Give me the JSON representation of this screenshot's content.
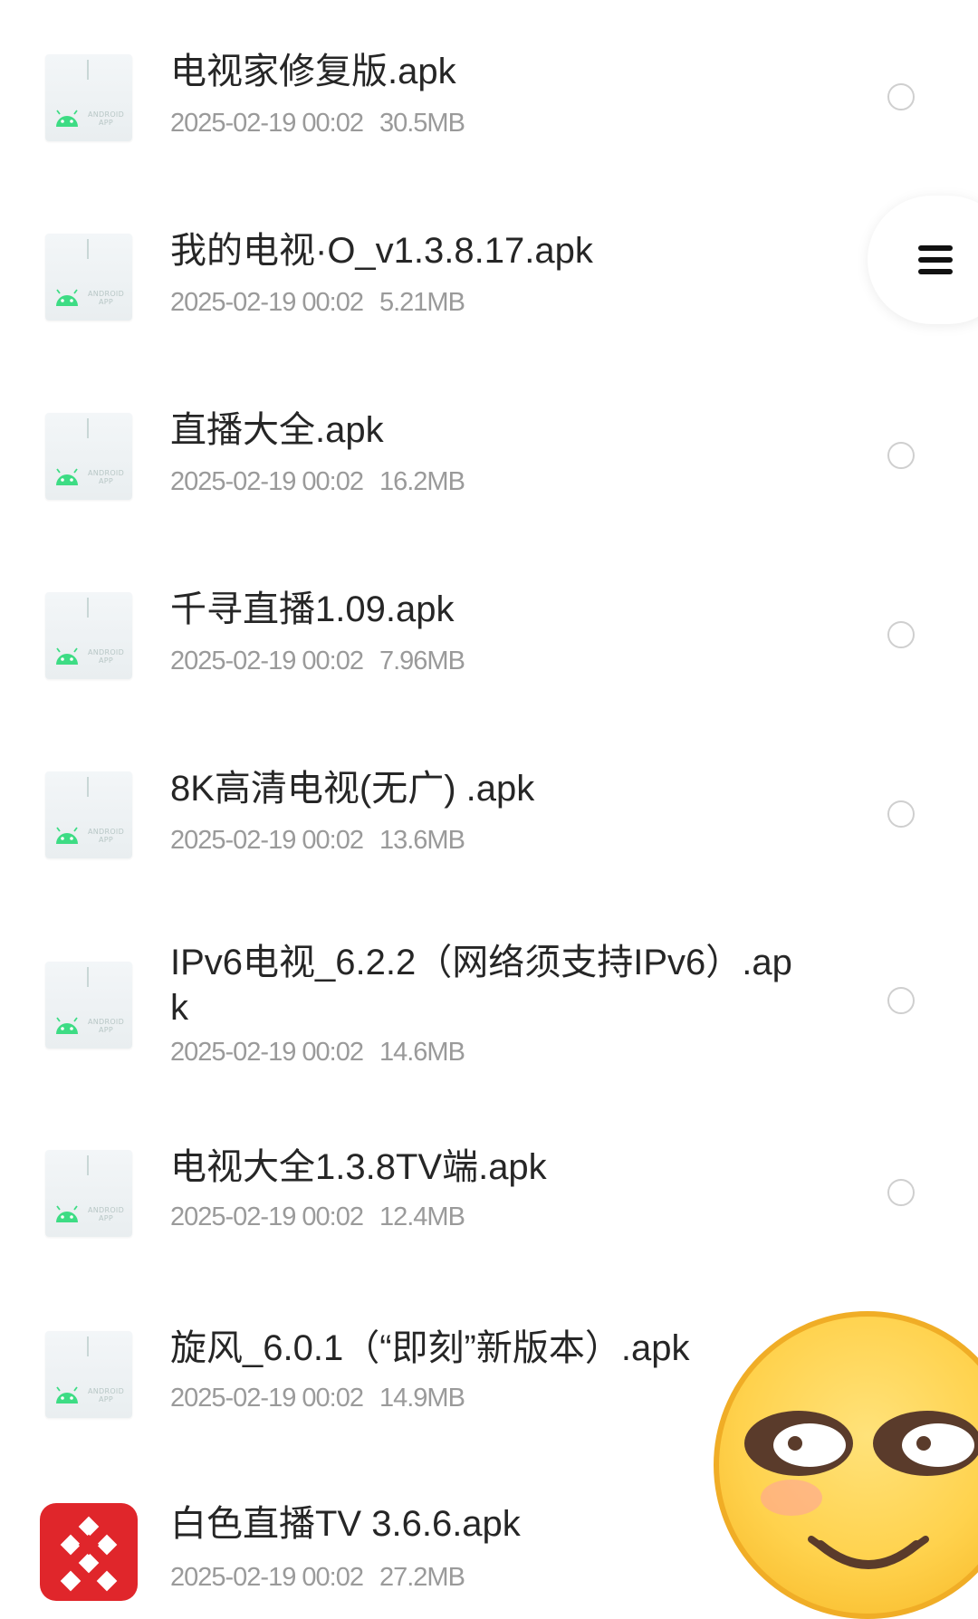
{
  "files": [
    {
      "name": "电视家修复版.apk",
      "date": "2025-02-19 00:02",
      "size": "30.5MB",
      "icon": "android-apk-icon",
      "has_radio": true
    },
    {
      "name": "我的电视·O_v1.3.8.17.apk",
      "date": "2025-02-19 00:02",
      "size": "5.21MB",
      "icon": "android-apk-icon",
      "has_radio": false
    },
    {
      "name": "直播大全.apk",
      "date": "2025-02-19 00:02",
      "size": "16.2MB",
      "icon": "android-apk-icon",
      "has_radio": true
    },
    {
      "name": "千寻直播1.09.apk",
      "date": "2025-02-19 00:02",
      "size": "7.96MB",
      "icon": "android-apk-icon",
      "has_radio": true
    },
    {
      "name": "8K高清电视(无广) .apk",
      "date": "2025-02-19 00:02",
      "size": "13.6MB",
      "icon": "android-apk-icon",
      "has_radio": true
    },
    {
      "name": "IPv6电视_6.2.2（网络须支持IPv6）.apk",
      "date": "2025-02-19 00:02",
      "size": "14.6MB",
      "icon": "android-apk-icon",
      "has_radio": true
    },
    {
      "name": "电视大全1.3.8TV端.apk",
      "date": "2025-02-19 00:02",
      "size": "12.4MB",
      "icon": "android-apk-icon",
      "has_radio": true
    },
    {
      "name": "旋风_6.0.1（“即刻”新版本）.apk",
      "date": "2025-02-19 00:02",
      "size": "14.9MB",
      "icon": "android-apk-icon",
      "has_radio": false
    },
    {
      "name": "白色直播TV 3.6.6.apk",
      "date": "2025-02-19 00:02",
      "size": "27.2MB",
      "icon": "red-app-logo-icon",
      "has_radio": false
    }
  ],
  "apk_icon_label": "ANDROID APP",
  "floating_button": {
    "icon": "menu-icon"
  },
  "overlay": {
    "icon": "smiling-emoji-icon"
  },
  "colors": {
    "text": "#262626",
    "meta": "#9a9a9a",
    "android_green": "#3ddc84",
    "app_red": "#e0262b",
    "emoji_yellow": "#ffd24d"
  }
}
